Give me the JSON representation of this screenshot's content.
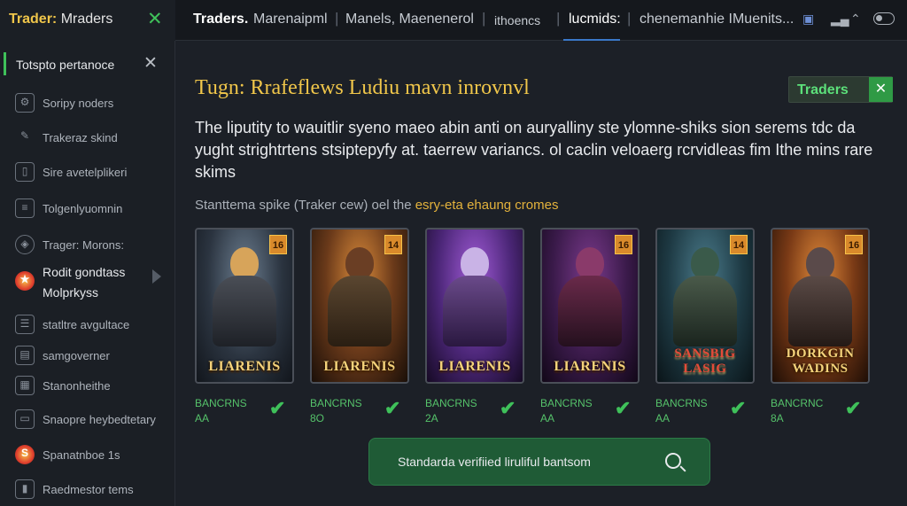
{
  "topbar": {
    "brand": {
      "prefix": "Trader:",
      "name": "Mraders"
    },
    "tabs": [
      {
        "label": "Traders.",
        "active": false
      },
      {
        "label": "Marenaipml",
        "active": false
      },
      {
        "label": "Manels, Maenenerol",
        "active": false
      },
      {
        "label": "ithoencs",
        "active": false
      },
      {
        "label": "lucmids:",
        "active": true
      },
      {
        "label": "chenemanhie IMuenits...",
        "active": false
      }
    ],
    "tray_icons": [
      "app-icon",
      "signal-icon",
      "wifi-icon",
      "toggle-icon"
    ]
  },
  "sidebar": {
    "header": "Totspto pertanoce",
    "items": [
      {
        "label": "Soripy noders",
        "icon": "gear-icon"
      },
      {
        "label": "Trakeraz skind",
        "icon": "brush-icon"
      },
      {
        "label": "Sire avetelplikeri",
        "icon": "phone-icon"
      },
      {
        "label": "Tolgenlyuomnin",
        "icon": "doc-icon"
      },
      {
        "label": "Trager: Morons:",
        "icon": "shield-icon"
      },
      {
        "label": "Rodit gondtass\nMolprkyss",
        "icon": "star-icon",
        "highlight": true
      },
      {
        "label": "statltre avgultace",
        "icon": "list-icon"
      },
      {
        "label": "samgoverner",
        "icon": "stack-icon"
      },
      {
        "label": "Stanonheithe",
        "icon": "box-icon"
      },
      {
        "label": "Snaopre heybedtetary",
        "icon": "card-icon"
      },
      {
        "label": "Spanatnboe 1s",
        "icon": "s-badge-icon"
      },
      {
        "label": "Raedmestor tems",
        "icon": "tag-icon"
      }
    ]
  },
  "main": {
    "heading": "Tugn: Rrafeflews Ludiu mavn inrovnvl",
    "badge": "Traders",
    "paragraph": "The liputity to wauitlir syeno maeo abin anti on auryalliny ste ylomne-shiks sion serems tdc da yught strightrtens stsiptepyfy at. taerrew variancs. ol caclin veloaerg rcrvidleas fim Ithe mins rare skims",
    "subline_prefix": "Stanttema spike (Traker cew) oel the",
    "subline_highlight": "esry-eta ehaung cromes",
    "cards": [
      {
        "name": "LIARENIS",
        "level": "16",
        "caption1": "BANCRNS",
        "caption2": "AA"
      },
      {
        "name": "LIARENIS",
        "level": "14",
        "caption1": "BANCRNS",
        "caption2": "8O"
      },
      {
        "name": "LIARENIS",
        "level": "",
        "caption1": "BANCRNS",
        "caption2": "2A"
      },
      {
        "name": "LIARENIS",
        "level": "16",
        "caption1": "BANCRNS",
        "caption2": "AA"
      },
      {
        "name": "SANSBIG LASIG",
        "level": "14",
        "caption1": "BANCRNS",
        "caption2": "AA"
      },
      {
        "name": "DORKGIN WADINS",
        "level": "16",
        "caption1": "BANCRNC",
        "caption2": "8A"
      }
    ],
    "search_text": "Standarda verifiied liruliful bantsom"
  },
  "colors": {
    "accent_gold": "#f0c64a",
    "accent_green": "#3fc15a",
    "background": "#1c2027"
  }
}
